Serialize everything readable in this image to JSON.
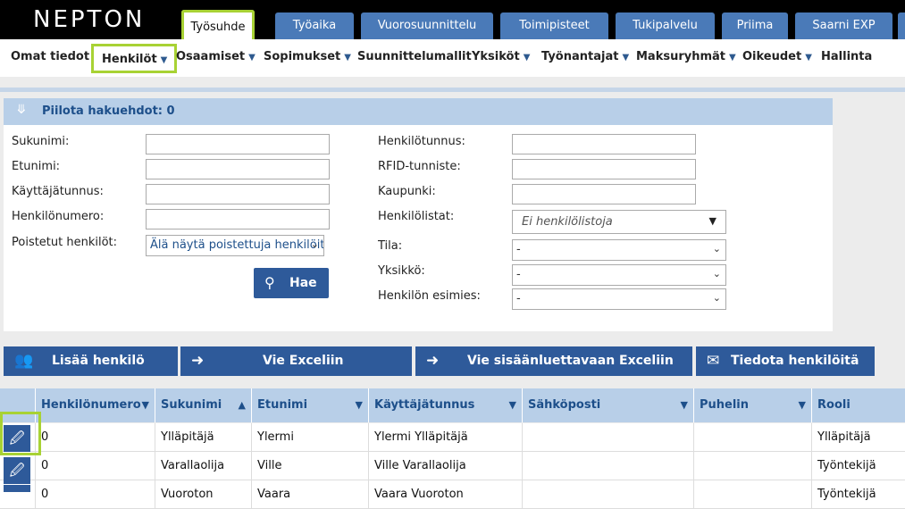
{
  "logo": "NEPTON",
  "tabs": [
    "Työsuhde",
    "Työaika",
    "Vuorosuunnittelu",
    "Toimipisteet",
    "Tukipalvelu",
    "Priima",
    "Saarni EXP"
  ],
  "subnav": [
    "Omat tiedot",
    "Henkilöt",
    "Osaamiset",
    "Sopimukset",
    "Suunnittelumallit",
    "Yksiköt",
    "Työnantajat",
    "Maksuryhmät",
    "Oikeudet",
    "Hallinta"
  ],
  "filters": {
    "toggle_label": "Piilota hakuehdot: 0",
    "left_labels": [
      "Sukunimi:",
      "Etunimi:",
      "Käyttäjätunnus:",
      "Henkilönumero:",
      "Poistetut henkilöt:"
    ],
    "deleted_value": "Älä näytä poistettuja henkilöitä",
    "right_labels": [
      "Henkilötunnus:",
      "RFID-tunniste:",
      "Kaupunki:",
      "Henkilölistat:",
      "Tila:",
      "Yksikkö:",
      "Henkilön esimies:"
    ],
    "lists_value": "Ei henkilölistoja",
    "tila_value": "-",
    "yksikko_value": "-",
    "esimies_value": "-",
    "search_label": "Hae"
  },
  "actions": {
    "add": "Lisää henkilö",
    "excel": "Vie Exceliin",
    "excel_import": "Vie sisäänluettavaan Exceliin",
    "notify": "Tiedota henkilöitä"
  },
  "table": {
    "columns": [
      "Henkilönumero",
      "Sukunimi",
      "Etunimi",
      "Käyttäjätunnus",
      "Sähköposti",
      "Puhelin",
      "Rooli"
    ],
    "rows": [
      [
        "0",
        "Ylläpitäjä",
        "Ylermi",
        "Ylermi Ylläpitäjä",
        "",
        "",
        "Ylläpitäjä"
      ],
      [
        "0",
        "Varallaolija",
        "Ville",
        "Ville Varallaolija",
        "",
        "",
        "Työntekijä"
      ],
      [
        "0",
        "Vuoroton",
        "Vaara",
        "Vaara Vuoroton",
        "",
        "",
        "Työntekijä"
      ]
    ]
  },
  "colors": {
    "accent": "#2e5a9a",
    "tab": "#4a7ab8",
    "highlight": "#a8d234",
    "header": "#b8cfe8"
  }
}
